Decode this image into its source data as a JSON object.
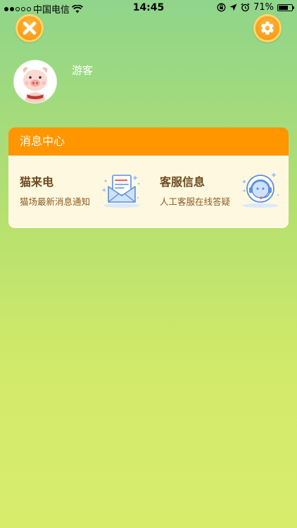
{
  "status_bar": {
    "carrier": "中国电信",
    "time": "14:45",
    "battery_percent": "71%",
    "battery_level": 0.71
  },
  "header": {
    "close_icon": "close-x-icon",
    "settings_icon": "gear-icon",
    "accent_color": "#f79a14"
  },
  "profile": {
    "username": "游客",
    "avatar_icon": "pig-avatar"
  },
  "message_center": {
    "title": "消息中心",
    "header_color": "#ff9600",
    "items": [
      {
        "title": "猫来电",
        "subtitle": "猫场最新消息通知",
        "icon": "envelope-icon"
      },
      {
        "title": "客服信息",
        "subtitle": "人工客服在线答疑",
        "icon": "headset-icon"
      }
    ]
  }
}
